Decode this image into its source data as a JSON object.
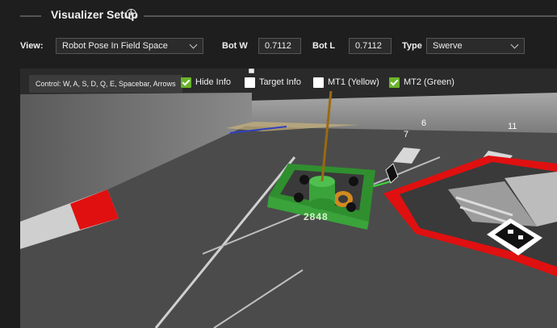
{
  "header": {
    "title": "Visualizer Setup",
    "info_icon": "info-icon"
  },
  "controls": {
    "view_label": "View:",
    "view_value": "Robot Pose In Field Space",
    "botw_label": "Bot W",
    "botw_value": "0.7112",
    "botl_label": "Bot L",
    "botl_value": "0.7112",
    "type_label": "Type",
    "type_value": "Swerve"
  },
  "viewport": {
    "control_hint": "Control: W, A, S, D, Q, E, Spacebar, Arrows",
    "toggles": [
      {
        "label": "Hide Info",
        "checked": true
      },
      {
        "label": "Target Info",
        "checked": false
      },
      {
        "label": "MT1 (Yellow)",
        "checked": false
      },
      {
        "label": "MT2 (Green)",
        "checked": true
      }
    ],
    "fiducial_numbers": [
      "6",
      "7",
      "11"
    ],
    "robot_team_number": "2848"
  },
  "colors": {
    "robot": "#3aa33a",
    "checkbox_on": "#69b32a",
    "field_border": "#e01010"
  }
}
